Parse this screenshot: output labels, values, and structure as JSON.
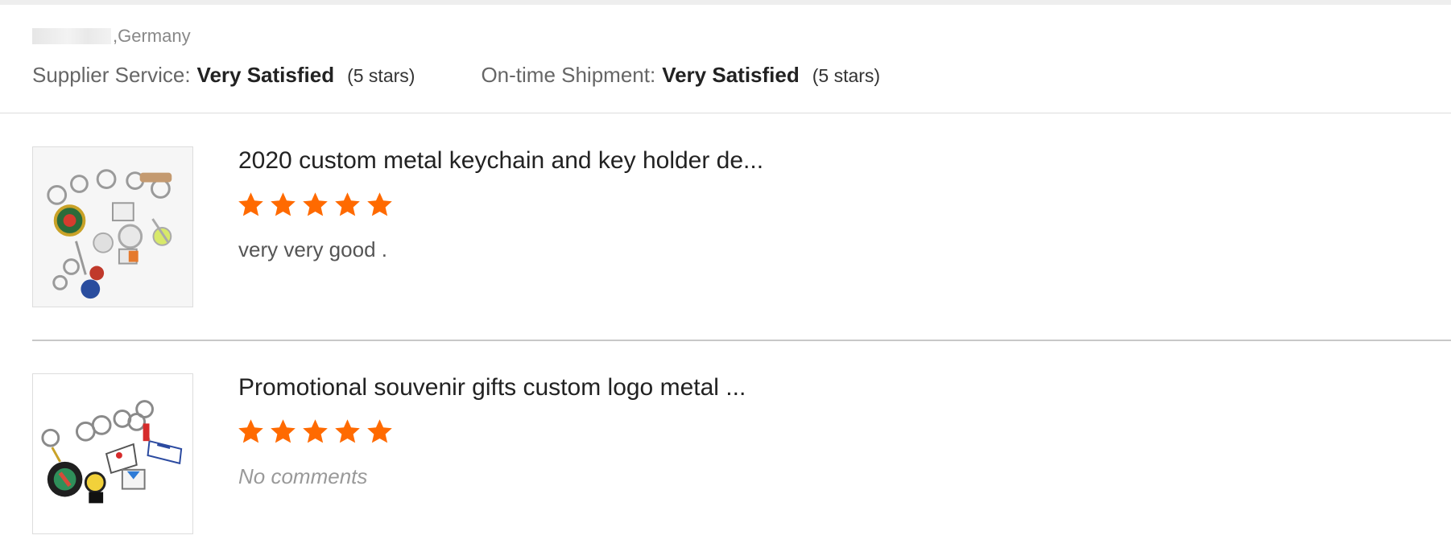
{
  "reviewer": {
    "location": ",Germany"
  },
  "ratings": {
    "supplier_service_label": "Supplier Service:",
    "supplier_service_value": "Very Satisfied",
    "supplier_service_stars": "(5 stars)",
    "shipment_label": "On-time Shipment:",
    "shipment_value": "Very Satisfied",
    "shipment_stars": "(5 stars)"
  },
  "reviews": [
    {
      "product_title": "2020 custom metal keychain and key holder de...",
      "stars": 5,
      "comment": "very very good ."
    },
    {
      "product_title": "Promotional souvenir gifts custom logo metal ...",
      "stars": 5,
      "comment": "No comments"
    }
  ],
  "colors": {
    "star": "#ff6a00",
    "divider": "#dddddd",
    "top_band": "#eeeeee"
  }
}
